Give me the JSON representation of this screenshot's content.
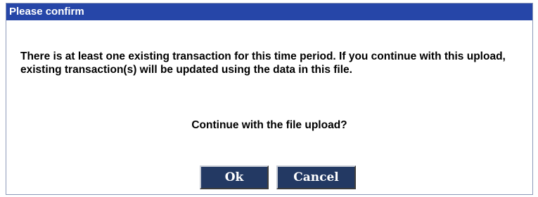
{
  "dialog": {
    "title": "Please confirm",
    "message": "There is at least one existing transaction for this time period. If you continue with this upload, existing transaction(s) will be updated using the data in this file.",
    "question": "Continue with the file upload?",
    "ok_label": "Ok",
    "cancel_label": "Cancel"
  },
  "colors": {
    "titlebar": "#2646a8",
    "button": "#233963",
    "border": "#8c98b8"
  }
}
